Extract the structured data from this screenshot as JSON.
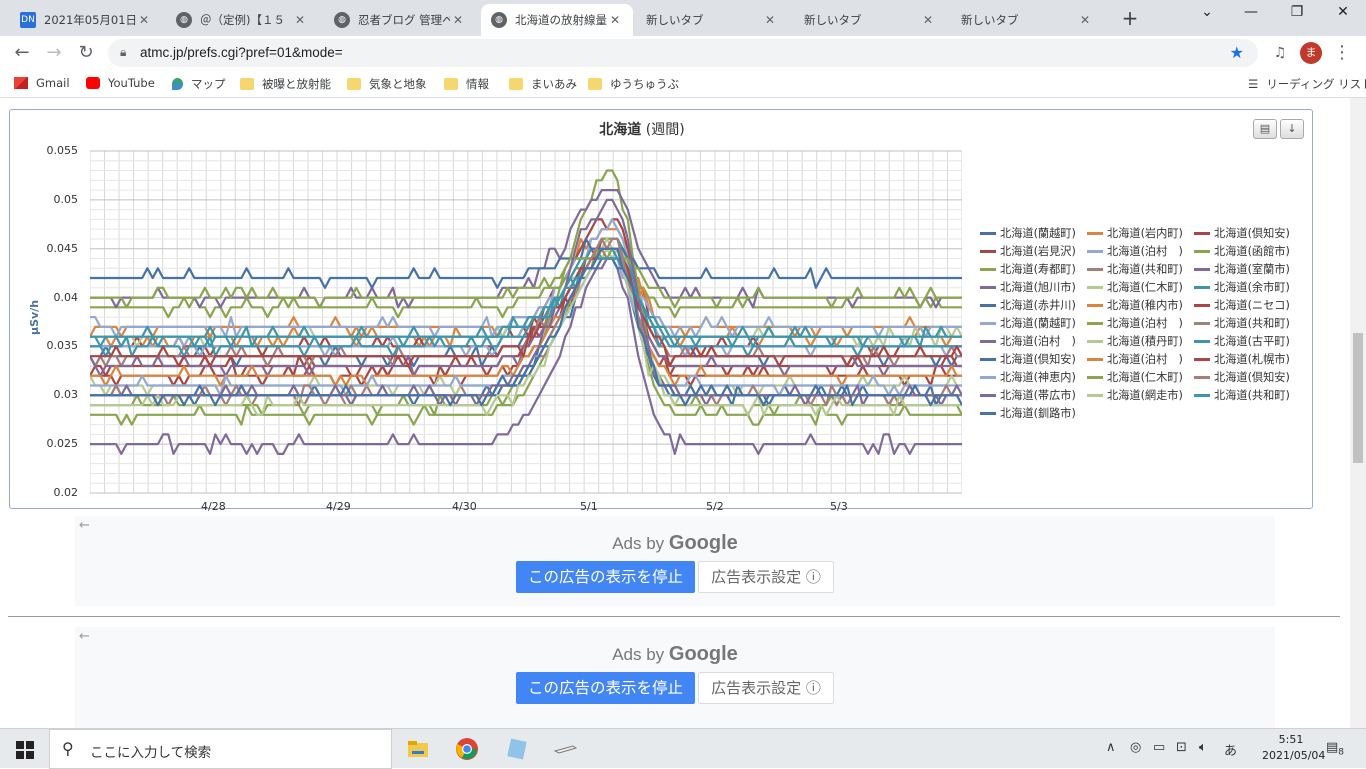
{
  "browser": {
    "tabs": [
      {
        "title": "2021年05月01日(土",
        "favicon": "blog-favicon",
        "active": false
      },
      {
        "title": "＠（定例)【１５",
        "favicon": "globe-icon",
        "active": false
      },
      {
        "title": "忍者ブログ 管理ペー",
        "favicon": "globe-icon",
        "active": false
      },
      {
        "title": "北海道の放射線量",
        "favicon": "globe-icon",
        "active": true
      },
      {
        "title": "新しいタブ",
        "favicon": "",
        "active": false
      },
      {
        "title": "新しいタブ",
        "favicon": "",
        "active": false
      },
      {
        "title": "新しいタブ",
        "favicon": "",
        "active": false
      }
    ],
    "url": "atmc.jp/prefs.cgi?pref=01&mode=",
    "profile_initial": "ま",
    "bookmarks": [
      {
        "label": "Gmail",
        "icon": "gmail-icon"
      },
      {
        "label": "YouTube",
        "icon": "youtube-icon"
      },
      {
        "label": "マップ",
        "icon": "maps-icon"
      },
      {
        "label": "被曝と放射能",
        "icon": "folder-icon"
      },
      {
        "label": "気象と地象",
        "icon": "folder-icon"
      },
      {
        "label": "情報",
        "icon": "folder-icon"
      },
      {
        "label": "まいあみ",
        "icon": "folder-icon"
      },
      {
        "label": "ゆうちゅうぶ",
        "icon": "folder-icon"
      }
    ],
    "reading_list": "リーディング リスト"
  },
  "chart_data": {
    "type": "line",
    "title": "北海道",
    "subtitle": "(週間)",
    "xlabel": "",
    "ylabel": "μSv/h",
    "ylim": [
      0.02,
      0.055
    ],
    "yticks": [
      "0.055",
      "0.05",
      "0.045",
      "0.04",
      "0.035",
      "0.03",
      "0.025",
      "0.02"
    ],
    "xticks": [
      "4/28",
      "4/29",
      "4/30",
      "5/1",
      "5/2",
      "5/3"
    ],
    "grid": true,
    "legend_position": "right",
    "series": [
      {
        "name": "北海道(蘭越町)",
        "color": "#4572a7",
        "baseline": 0.034,
        "peak": 0.046
      },
      {
        "name": "北海道(岩内町)",
        "color": "#db843d",
        "baseline": 0.036,
        "peak": 0.047
      },
      {
        "name": "北海道(倶知安)",
        "color": "#aa4643",
        "baseline": 0.035,
        "peak": 0.048
      },
      {
        "name": "北海道(岩見沢)",
        "color": "#aa4643",
        "baseline": 0.033,
        "peak": 0.046
      },
      {
        "name": "北海道(泊村　)",
        "color": "#93a9cf",
        "baseline": 0.035,
        "peak": 0.047
      },
      {
        "name": "北海道(函館市)",
        "color": "#89a54e",
        "baseline": 0.039,
        "peak": 0.044
      },
      {
        "name": "北海道(寿都町)",
        "color": "#89a54e",
        "baseline": 0.029,
        "peak": 0.053
      },
      {
        "name": "北海道(共和町)",
        "color": "#a47d7c",
        "baseline": 0.034,
        "peak": 0.045
      },
      {
        "name": "北海道(室蘭市)",
        "color": "#80699b",
        "baseline": 0.04,
        "peak": 0.051
      },
      {
        "name": "北海道(旭川市)",
        "color": "#80699b",
        "baseline": 0.025,
        "peak": 0.044
      },
      {
        "name": "北海道(仁木町)",
        "color": "#b5ca92",
        "baseline": 0.036,
        "peak": 0.045
      },
      {
        "name": "北海道(余市町)",
        "color": "#3d96ae",
        "baseline": 0.035,
        "peak": 0.046
      },
      {
        "name": "北海道(赤井川)",
        "color": "#4572a7",
        "baseline": 0.042,
        "peak": 0.045
      },
      {
        "name": "北海道(稚内市)",
        "color": "#db843d",
        "baseline": 0.037,
        "peak": 0.044
      },
      {
        "name": "北海道(ニセコ)",
        "color": "#aa4643",
        "baseline": 0.032,
        "peak": 0.045
      },
      {
        "name": "北海道(蘭越町)",
        "color": "#93a9cf",
        "baseline": 0.037,
        "peak": 0.044
      },
      {
        "name": "北海道(泊村　)",
        "color": "#89a54e",
        "baseline": 0.028,
        "peak": 0.046
      },
      {
        "name": "北海道(共和町)",
        "color": "#a47d7c",
        "baseline": 0.03,
        "peak": 0.044
      },
      {
        "name": "北海道(泊村　)",
        "color": "#80699b",
        "baseline": 0.033,
        "peak": 0.045
      },
      {
        "name": "北海道(積丹町)",
        "color": "#b5ca92",
        "baseline": 0.031,
        "peak": 0.045
      },
      {
        "name": "北海道(古平町)",
        "color": "#3d96ae",
        "baseline": 0.036,
        "peak": 0.045
      },
      {
        "name": "北海道(倶知安)",
        "color": "#4572a7",
        "baseline": 0.03,
        "peak": 0.044
      },
      {
        "name": "北海道(泊村　)",
        "color": "#db843d",
        "baseline": 0.032,
        "peak": 0.045
      },
      {
        "name": "北海道(札幌市)",
        "color": "#aa4643",
        "baseline": 0.034,
        "peak": 0.045
      },
      {
        "name": "北海道(神恵内)",
        "color": "#93a9cf",
        "baseline": 0.031,
        "peak": 0.044
      },
      {
        "name": "北海道(仁木町)",
        "color": "#89a54e",
        "baseline": 0.04,
        "peak": 0.045
      },
      {
        "name": "北海道(倶知安)",
        "color": "#a47d7c",
        "baseline": 0.03,
        "peak": 0.046
      },
      {
        "name": "北海道(帯広市)",
        "color": "#80699b",
        "baseline": 0.03,
        "peak": 0.05
      },
      {
        "name": "北海道(網走市)",
        "color": "#b5ca92",
        "baseline": 0.029,
        "peak": 0.045
      },
      {
        "name": "北海道(共和町)",
        "color": "#3d96ae",
        "baseline": 0.036,
        "peak": 0.044
      },
      {
        "name": "北海道(釧路市)",
        "color": "#4572a7",
        "baseline": 0.03,
        "peak": 0.045
      }
    ]
  },
  "chart_buttons": {
    "print": "印刷",
    "download": "↓"
  },
  "ads": [
    {
      "ads_by": "Ads by",
      "google": "Google",
      "stop": "この広告の表示を停止",
      "settings": "広告表示設定 ⓘ"
    },
    {
      "ads_by": "Ads by",
      "google": "Google",
      "stop": "この広告の表示を停止",
      "settings": "広告表示設定 ⓘ"
    }
  ],
  "taskbar": {
    "search_placeholder": "ここに入力して検索",
    "time": "5:51",
    "date": "2021/05/04",
    "ime": "あ",
    "notification_count": "8"
  }
}
